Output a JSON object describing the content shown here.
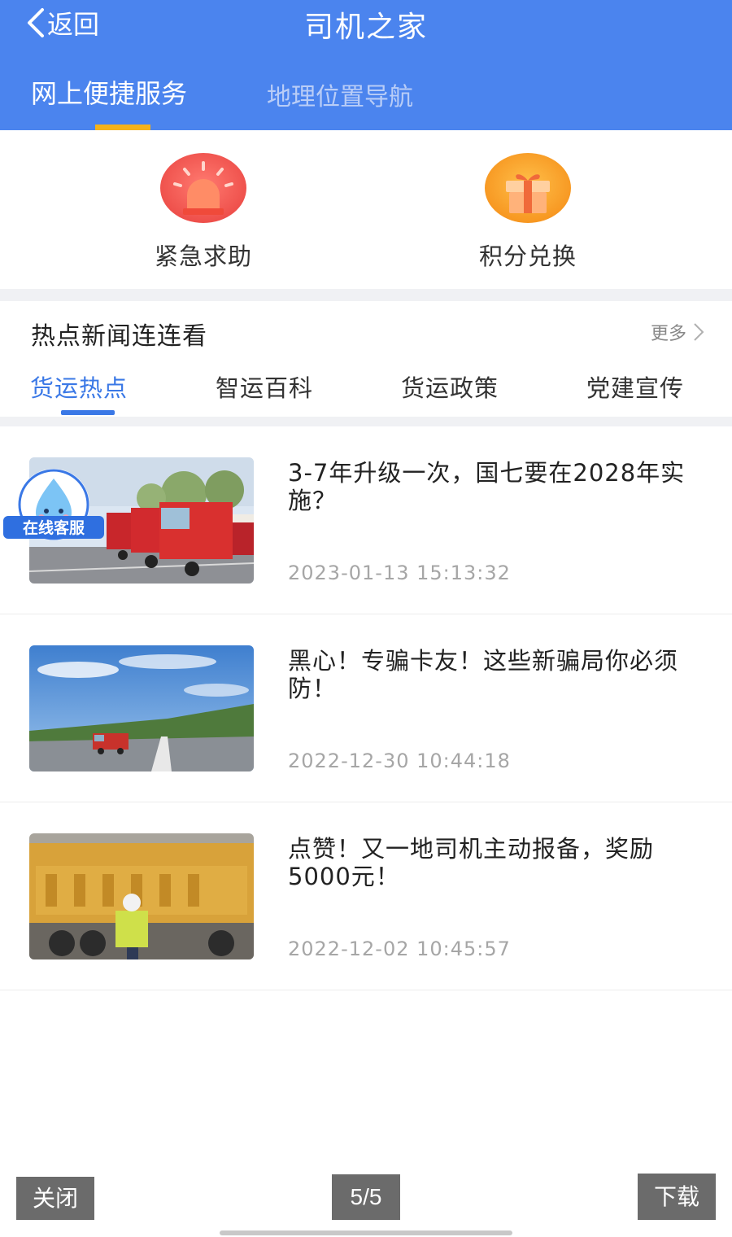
{
  "header": {
    "back_label": "返回",
    "title": "司机之家",
    "bg_color": "#4b84ee",
    "tabs": [
      {
        "label": "网上便捷服务",
        "active": true
      },
      {
        "label": "地理位置导航",
        "active": false
      }
    ],
    "tab_indicator_color": "#f5b21a"
  },
  "services": [
    {
      "label": "紧急求助",
      "icon": "siren-icon"
    },
    {
      "label": "积分兑换",
      "icon": "gift-icon"
    }
  ],
  "news": {
    "title": "热点新闻连连看",
    "more_label": "更多",
    "categories": [
      {
        "label": "货运热点",
        "active": true
      },
      {
        "label": "智运百科",
        "active": false
      },
      {
        "label": "货运政策",
        "active": false
      },
      {
        "label": "党建宣传",
        "active": false
      }
    ],
    "accent_color": "#3a78e6",
    "items": [
      {
        "title": "3-7年升级一次，国七要在2028年实施？",
        "date": "2023-01-13 15:13:32",
        "thumb": "red-trucks-photo"
      },
      {
        "title": "黑心！专骗卡友！这些新骗局你必须防！",
        "date": "2022-12-30 10:44:18",
        "thumb": "highway-truck-photo"
      },
      {
        "title": "点赞！又一地司机主动报备，奖励5000元！",
        "date": "2022-12-02 10:45:57",
        "thumb": "yellow-truck-police-photo"
      }
    ]
  },
  "floating": {
    "label": "在线客服"
  },
  "viewer": {
    "close_label": "关闭",
    "page_indicator": "5/5",
    "download_label": "下载"
  }
}
